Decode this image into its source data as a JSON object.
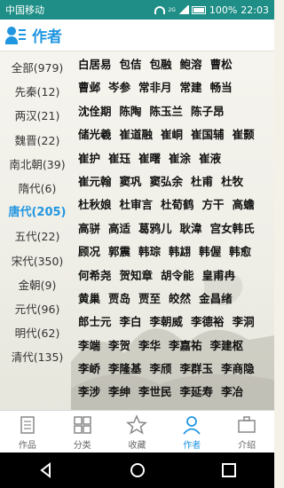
{
  "status_bar": {
    "carrier": "中国移动",
    "battery": "100%",
    "time": "22:03",
    "signal_badge": "2G"
  },
  "header": {
    "title": "作者",
    "icon": "author-icon"
  },
  "sidebar": {
    "items": [
      {
        "label": "全部(979)"
      },
      {
        "label": "先秦(12)"
      },
      {
        "label": "两汉(21)"
      },
      {
        "label": "魏晋(22)"
      },
      {
        "label": "南北朝(39)"
      },
      {
        "label": "隋代(6)"
      },
      {
        "label": "唐代(205)",
        "active": true
      },
      {
        "label": "五代(22)"
      },
      {
        "label": "宋代(350)"
      },
      {
        "label": "金朝(9)"
      },
      {
        "label": "元代(96)"
      },
      {
        "label": "明代(62)"
      },
      {
        "label": "清代(135)"
      }
    ]
  },
  "authors": {
    "rows": [
      [
        "白居易",
        "包佶",
        "包融",
        "鲍溶",
        "曹松"
      ],
      [
        "曹邺",
        "岑参",
        "常非月",
        "常建",
        "畅当"
      ],
      [
        "沈佺期",
        "陈陶",
        "陈玉兰",
        "陈子昂"
      ],
      [
        "储光羲",
        "崔道融",
        "崔峒",
        "崔国辅",
        "崔颢"
      ],
      [
        "崔护",
        "崔珏",
        "崔曙",
        "崔涂",
        "崔液"
      ],
      [
        "崔元翰",
        "窦巩",
        "窦弘余",
        "杜甫",
        "杜牧"
      ],
      [
        "杜秋娘",
        "杜审言",
        "杜荀鹤",
        "方干",
        "高蟾"
      ],
      [
        "高骈",
        "高适",
        "葛鸦儿",
        "耿湋",
        "宫女韩氏"
      ],
      [
        "顾况",
        "郭震",
        "韩琮",
        "韩翃",
        "韩偓",
        "韩愈"
      ],
      [
        "何希尧",
        "贺知章",
        "胡令能",
        "皇甫冉"
      ],
      [
        "黄巢",
        "贾岛",
        "贾至",
        "皎然",
        "金昌绪"
      ],
      [
        "郎士元",
        "李白",
        "李朝威",
        "李德裕",
        "李洞"
      ],
      [
        "李端",
        "李贺",
        "李华",
        "李嘉祐",
        "李建枢"
      ],
      [
        "李峤",
        "李隆基",
        "李颀",
        "李群玉",
        "李商隐"
      ],
      [
        "李涉",
        "李绅",
        "李世民",
        "李延寿",
        "李冶"
      ]
    ]
  },
  "tabs": [
    {
      "label": "作品",
      "icon": "document-icon"
    },
    {
      "label": "分类",
      "icon": "grid-icon"
    },
    {
      "label": "收藏",
      "icon": "star-icon"
    },
    {
      "label": "作者",
      "icon": "person-icon",
      "active": true
    },
    {
      "label": "介绍",
      "icon": "briefcase-icon"
    }
  ],
  "colors": {
    "accent": "#2196e0",
    "status_bar": "#1e8e86",
    "text": "#111111"
  }
}
